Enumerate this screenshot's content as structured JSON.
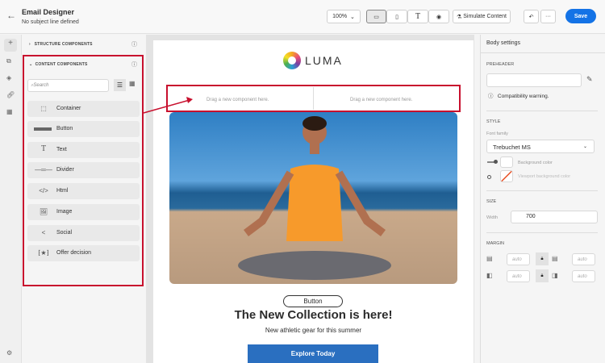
{
  "header": {
    "title": "Email Designer",
    "subtitle": "No subject line defined",
    "zoom": "100%",
    "simulate": "Simulate Content",
    "save": "Save"
  },
  "left_panel": {
    "structure_title": "STRUCTURE COMPONENTS",
    "content_title": "CONTENT COMPONENTS",
    "search_placeholder": "Search",
    "items": [
      {
        "label": "Container",
        "icon": "container-icon"
      },
      {
        "label": "Button",
        "icon": "button-icon"
      },
      {
        "label": "Text",
        "icon": "text-icon"
      },
      {
        "label": "Divider",
        "icon": "divider-icon"
      },
      {
        "label": "Html",
        "icon": "code-icon"
      },
      {
        "label": "Image",
        "icon": "image-icon"
      },
      {
        "label": "Social",
        "icon": "share-icon"
      },
      {
        "label": "Offer decision",
        "icon": "offer-icon"
      }
    ]
  },
  "email": {
    "logo": "LUMA",
    "drop_left": "Drag a new component here.",
    "drop_right": "Drag a new component here.",
    "button": "Button",
    "headline": "The New Collection is here!",
    "subline": "New athletic gear for this summer",
    "cta": "Explore Today"
  },
  "right_panel": {
    "title": "Body settings",
    "preheader": "PREHEADER",
    "warning": "Compatibility warning.",
    "style": "STYLE",
    "font_family_label": "Font family",
    "font_family": "Trebuchet MS",
    "bg_color": "Background color",
    "viewport_bg": "Viewport background color",
    "size": "SIZE",
    "width_label": "Width",
    "width": "700",
    "margin": "MARGIN",
    "margin_values": [
      "auto",
      "auto",
      "auto",
      "auto"
    ]
  },
  "colors": {
    "accent": "#1473e6",
    "highlight": "#c8102e"
  }
}
